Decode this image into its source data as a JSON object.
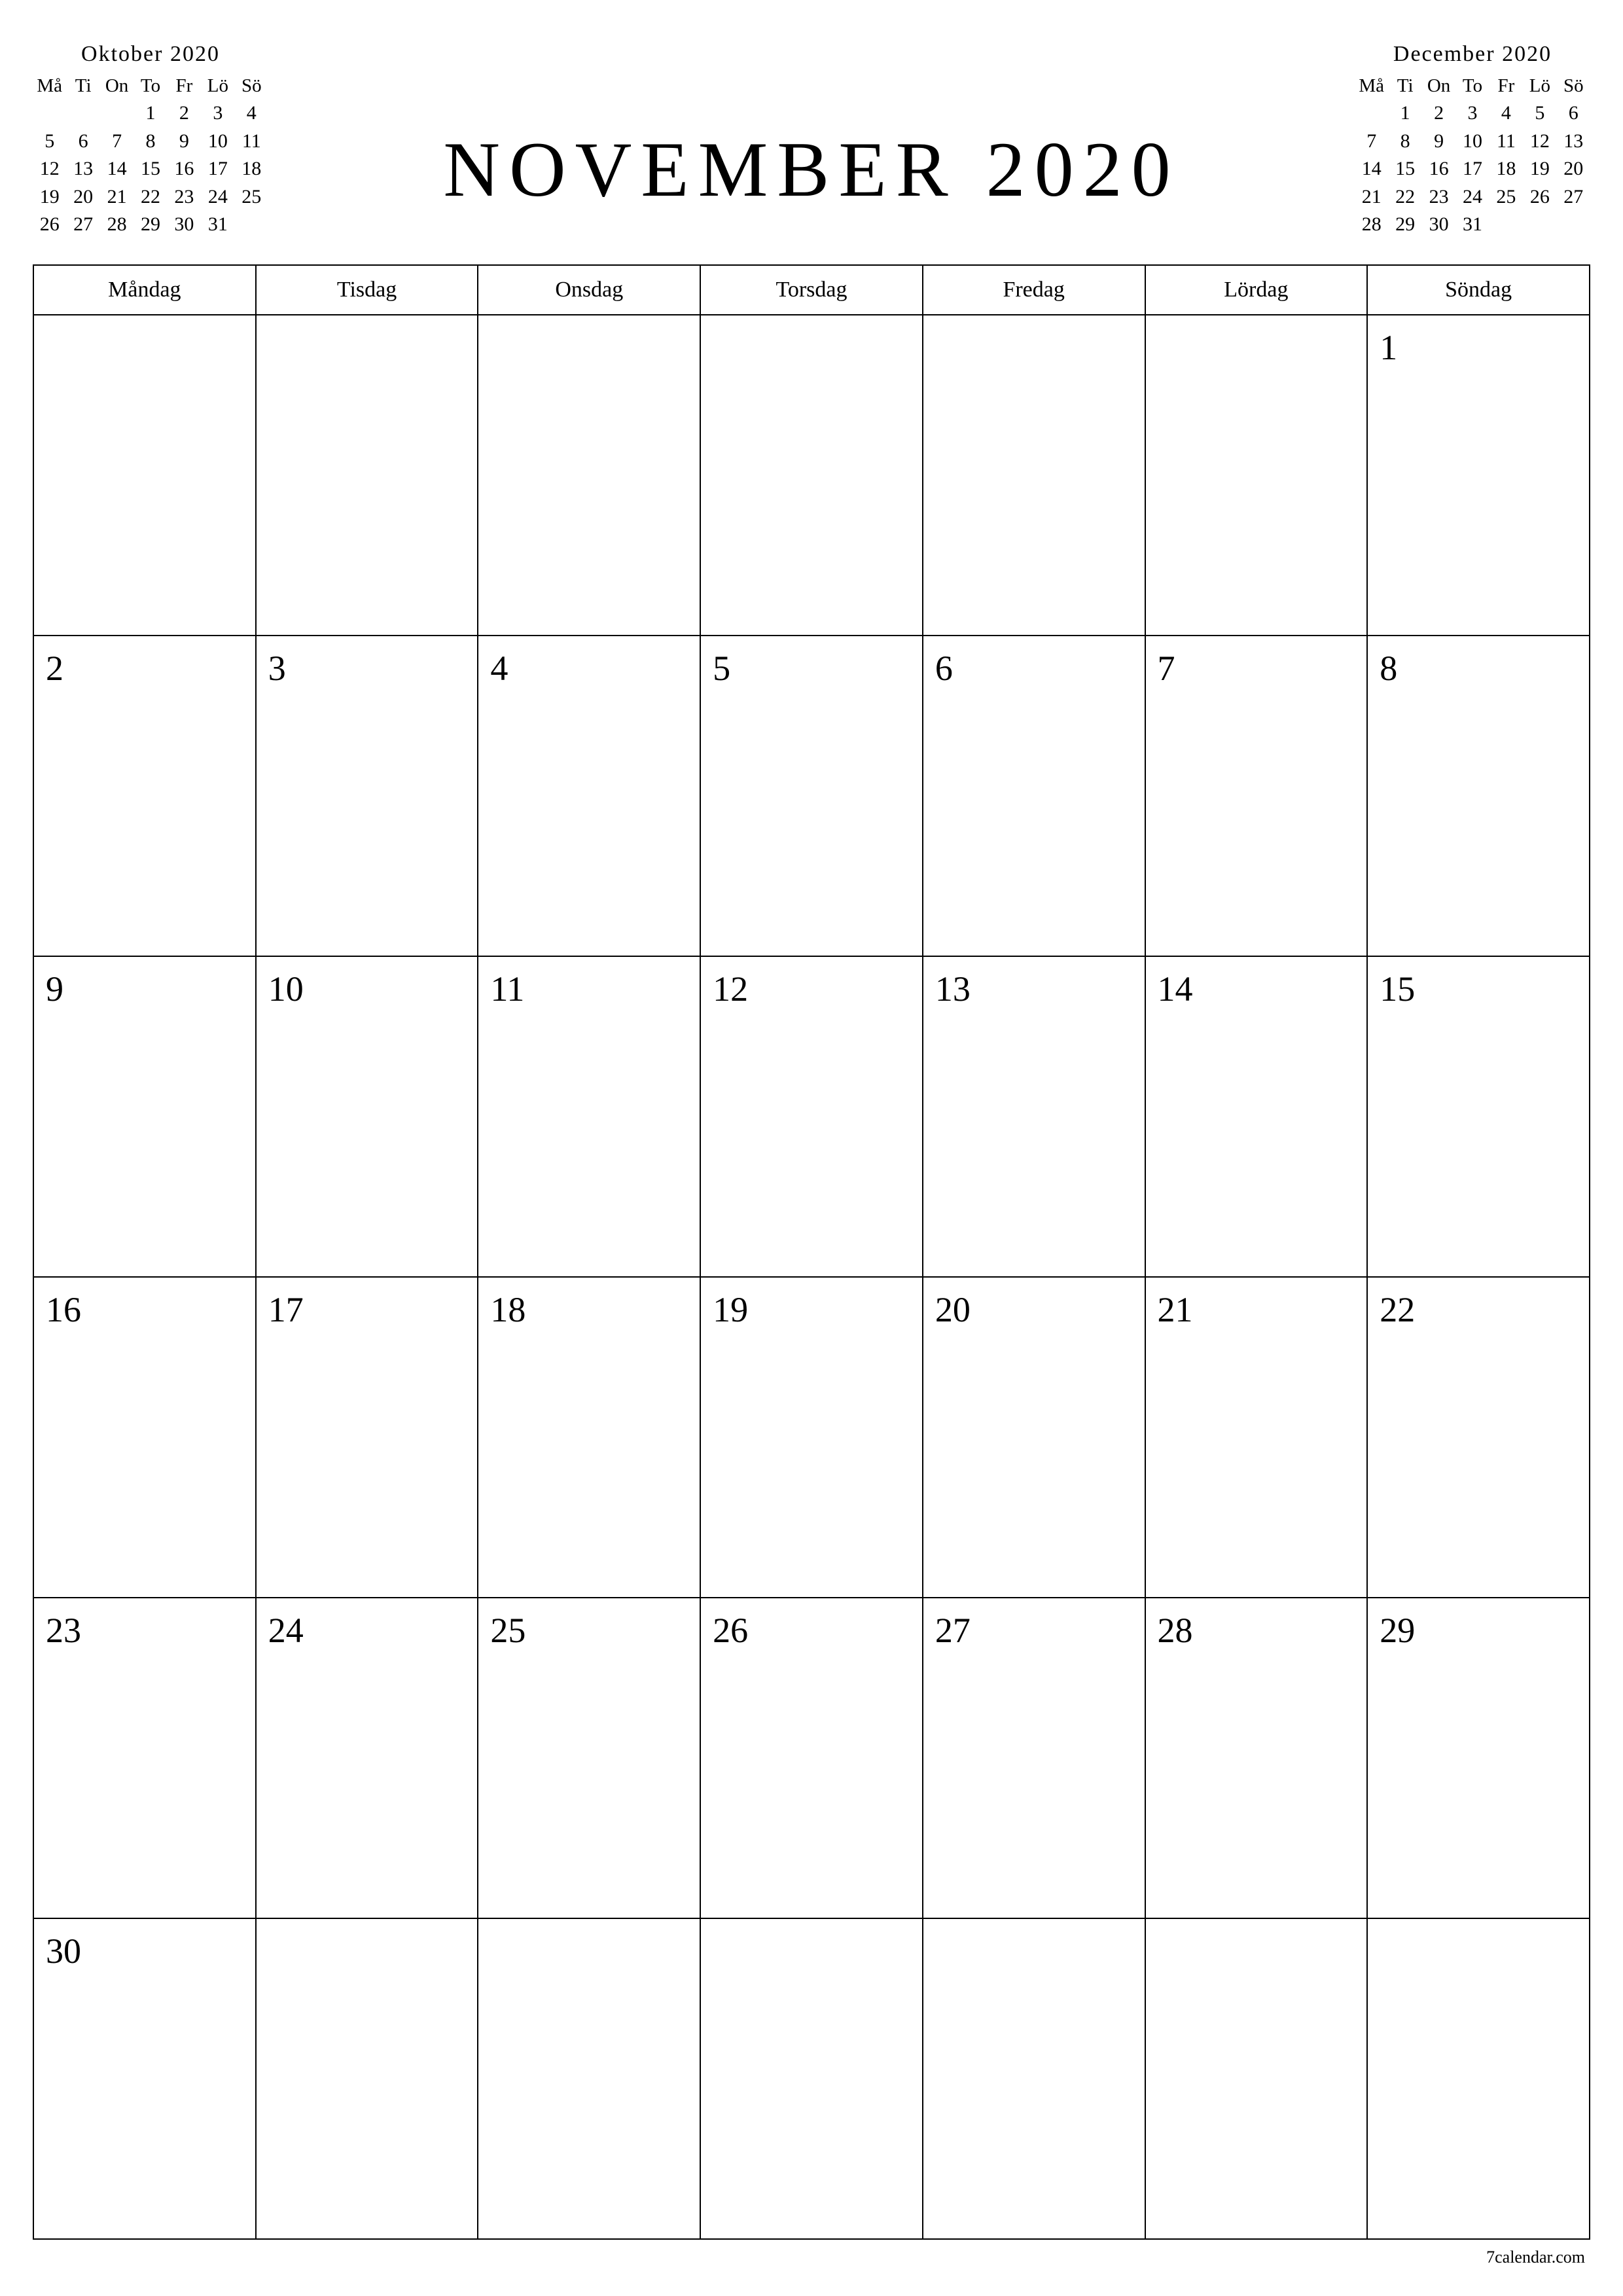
{
  "title": "NOVEMBER 2020",
  "weekday_headers": [
    "Måndag",
    "Tisdag",
    "Onsdag",
    "Torsdag",
    "Fredag",
    "Lördag",
    "Söndag"
  ],
  "weekday_short": [
    "Må",
    "Ti",
    "On",
    "To",
    "Fr",
    "Lö",
    "Sö"
  ],
  "prev_month": {
    "title": "Oktober 2020",
    "grid": [
      [
        "",
        "",
        "",
        "1",
        "2",
        "3",
        "4"
      ],
      [
        "5",
        "6",
        "7",
        "8",
        "9",
        "10",
        "11"
      ],
      [
        "12",
        "13",
        "14",
        "15",
        "16",
        "17",
        "18"
      ],
      [
        "19",
        "20",
        "21",
        "22",
        "23",
        "24",
        "25"
      ],
      [
        "26",
        "27",
        "28",
        "29",
        "30",
        "31",
        ""
      ]
    ]
  },
  "next_month": {
    "title": "December 2020",
    "grid": [
      [
        "",
        "1",
        "2",
        "3",
        "4",
        "5",
        "6"
      ],
      [
        "7",
        "8",
        "9",
        "10",
        "11",
        "12",
        "13"
      ],
      [
        "14",
        "15",
        "16",
        "17",
        "18",
        "19",
        "20"
      ],
      [
        "21",
        "22",
        "23",
        "24",
        "25",
        "26",
        "27"
      ],
      [
        "28",
        "29",
        "30",
        "31",
        "",
        "",
        ""
      ]
    ]
  },
  "main_grid": [
    [
      "",
      "",
      "",
      "",
      "",
      "",
      "1"
    ],
    [
      "2",
      "3",
      "4",
      "5",
      "6",
      "7",
      "8"
    ],
    [
      "9",
      "10",
      "11",
      "12",
      "13",
      "14",
      "15"
    ],
    [
      "16",
      "17",
      "18",
      "19",
      "20",
      "21",
      "22"
    ],
    [
      "23",
      "24",
      "25",
      "26",
      "27",
      "28",
      "29"
    ],
    [
      "30",
      "",
      "",
      "",
      "",
      "",
      ""
    ]
  ],
  "footer": "7calendar.com"
}
